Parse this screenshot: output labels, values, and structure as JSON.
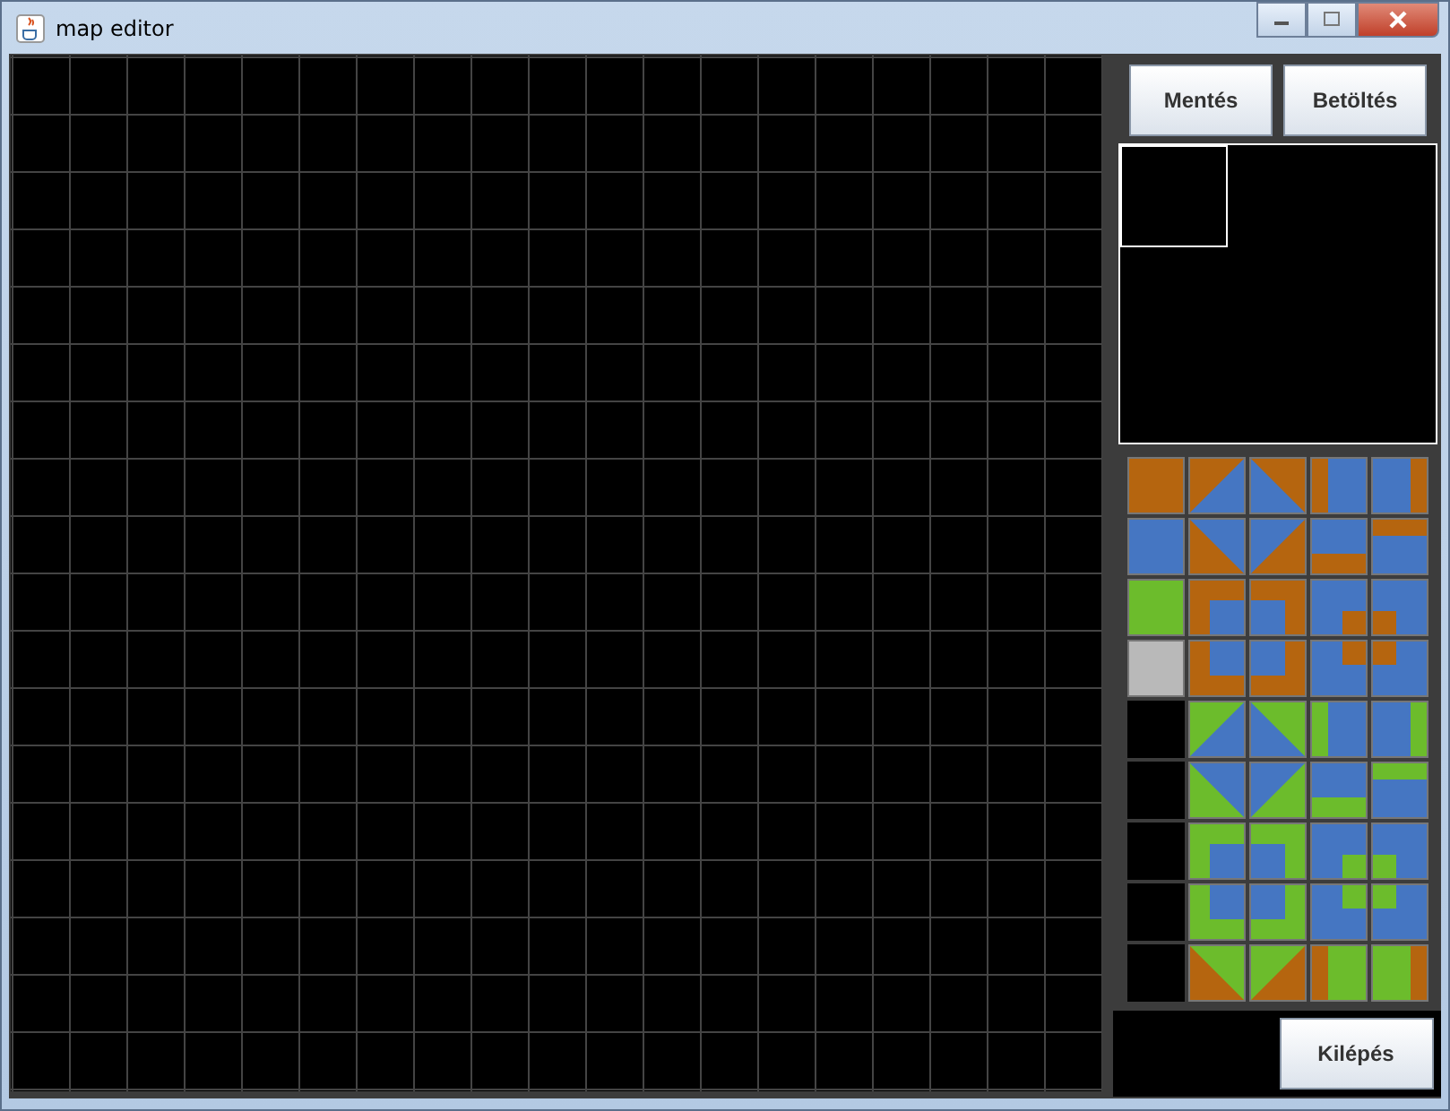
{
  "window": {
    "title": "map editor"
  },
  "buttons": [
    "Mentés",
    "Betöltés"
  ],
  "exit_button": {
    "label": "Kilépés"
  }
}
